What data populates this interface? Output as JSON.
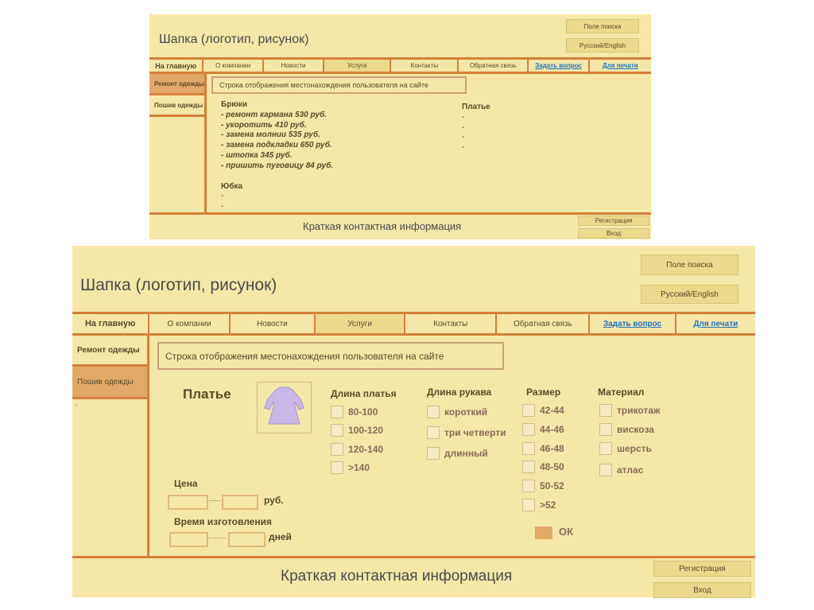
{
  "top": {
    "header_title": "Шапка (логотип, рисунок)",
    "search": "Поле поиска",
    "lang": "Русский/English",
    "nav": [
      "На главную",
      "О компании",
      "Новости",
      "Услуги",
      "Контакты",
      "Обратная связь",
      "Задать вопрос",
      "Для печати"
    ],
    "side": [
      "Ремонт одежды",
      "Пошив одежды"
    ],
    "breadcrumb": "Строка отображения местонахождения пользователя на сайте",
    "brюки_title": "Брюки",
    "bryuki_items": [
      "- ремонт кармана 530 руб.",
      "- укоротить 410 руб.",
      "- замена молнии 535 руб.",
      "- замена подкладки 650 руб.",
      "- штопка 345 руб.",
      "- пришить пуговицу 84 руб."
    ],
    "yubka_title": "Юбка",
    "yubka_items": [
      "-",
      "-"
    ],
    "platye_title": "Платье",
    "platye_items": [
      "-",
      "-",
      "-",
      "-"
    ],
    "footer": "Краткая контактная информация",
    "register": "Регистрация",
    "login": "Вход"
  },
  "bottom": {
    "header_title": "Шапка (логотип, рисунок)",
    "search": "Поле поиска",
    "lang": "Русский/English",
    "nav": [
      "На главную",
      "О компании",
      "Новости",
      "Услуги",
      "Контакты",
      "Обратная связь",
      "Задать вопрос",
      "Для печати"
    ],
    "side": [
      "Ремонт одежды",
      "Пошив одежды"
    ],
    "side_dot": ".",
    "breadcrumb": "Строка отображения местонахождения пользователя на сайте",
    "product_title": "Платье",
    "filters": {
      "length": {
        "title": "Длина платья",
        "options": [
          "80-100",
          "100-120",
          "120-140",
          ">140"
        ]
      },
      "sleeve": {
        "title": "Длина рукава",
        "options": [
          "короткий",
          "три четверти",
          "длинный"
        ]
      },
      "size": {
        "title": "Размер",
        "options": [
          "42-44",
          "44-46",
          "46-48",
          "48-50",
          "50-52",
          ">52"
        ]
      },
      "material": {
        "title": "Материал",
        "options": [
          "трикотаж",
          "вискоза",
          "шерсть",
          "атлас"
        ]
      }
    },
    "price": {
      "title": "Цена",
      "unit": "руб."
    },
    "time": {
      "title": "Время изготовления",
      "unit": "дней"
    },
    "ok": "ОК",
    "footer": "Краткая контактная информация",
    "register": "Регистрация",
    "login": "Вход"
  },
  "colors": {
    "panel": "#f5e7a7",
    "border": "#d57f3a",
    "link": "#1a73c9",
    "dress": "#c9b7e6"
  }
}
